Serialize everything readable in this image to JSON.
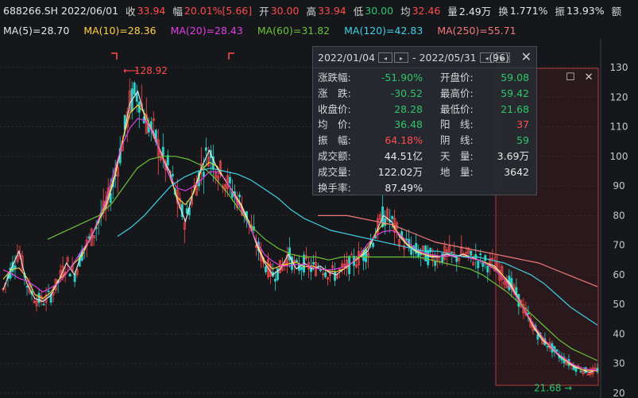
{
  "quote": {
    "code_date": "688266.SH 2022/06/01",
    "close_label": "收",
    "close": "33.94",
    "change_label": "幅",
    "change_pct": "20.01%[5.66]",
    "open_label": "开",
    "open": "30.00",
    "high_label": "高",
    "high": "33.94",
    "low_label": "低",
    "low": "30.00",
    "avg_label": "均",
    "avg": "32.46",
    "volume_label": "量",
    "volume": "2.49万",
    "turnover_label": "换",
    "turnover": "1.771%",
    "amplitude_label": "振",
    "amplitude": "13.93%",
    "amount_label": "额"
  },
  "ma_legend": [
    {
      "label": "MA(5)=28.70",
      "color": "#e8e8e8"
    },
    {
      "label": "MA(10)=28.36",
      "color": "#ffd23f"
    },
    {
      "label": "MA(20)=28.43",
      "color": "#e040e0"
    },
    {
      "label": "MA(60)=31.82",
      "color": "#6ac23a"
    },
    {
      "label": "MA(120)=42.83",
      "color": "#3fd1e6"
    },
    {
      "label": "MA(250)=55.71",
      "color": "#f07a7a"
    }
  ],
  "popup": {
    "range": "2022/01/04 - 2022/05/31",
    "count": "(96)",
    "close_icon": "close-icon",
    "rows_left": [
      {
        "label": "涨跌幅:",
        "value": "-51.90%",
        "color": "#2fc56b"
      },
      {
        "label": "涨　跌:",
        "value": "-30.52",
        "color": "#2fc56b"
      },
      {
        "label": "收盘价:",
        "value": "28.28",
        "color": "#2fc56b"
      },
      {
        "label": "均　价:",
        "value": "36.48",
        "color": "#2fc56b"
      },
      {
        "label": "振　幅:",
        "value": "64.18%",
        "color": "#ff4d4d"
      },
      {
        "label": "成交额:",
        "value": "44.51亿",
        "color": "#e8e8e8"
      },
      {
        "label": "成交量:",
        "value": "122.02万",
        "color": "#e8e8e8"
      },
      {
        "label": "换手率:",
        "value": "87.49%",
        "color": "#e8e8e8"
      }
    ],
    "rows_right": [
      {
        "label": "开盘价:",
        "value": "59.08",
        "color": "#2fc56b"
      },
      {
        "label": "最高价:",
        "value": "59.42",
        "color": "#2fc56b"
      },
      {
        "label": "最低价:",
        "value": "21.68",
        "color": "#2fc56b"
      },
      {
        "label": "阳　线:",
        "value": "37",
        "color": "#ff4d4d"
      },
      {
        "label": "阴　线:",
        "value": "59",
        "color": "#2fc56b"
      },
      {
        "label": "天　量:",
        "value": "3.69万",
        "color": "#e8e8e8"
      },
      {
        "label": "地　量:",
        "value": "3642",
        "color": "#e8e8e8"
      }
    ]
  },
  "chart_data": {
    "type": "candlestick",
    "y_ticks": [
      "130",
      "120",
      "110",
      "100",
      "90",
      "80",
      "70",
      "60",
      "50",
      "40",
      "30",
      "20"
    ],
    "ylim": [
      20,
      130
    ],
    "high_annotation": "128.92",
    "low_annotation": "21.68",
    "close_path": [
      55,
      62,
      68,
      57,
      52,
      51,
      53,
      58,
      64,
      60,
      68,
      72,
      78,
      83,
      92,
      104,
      118,
      122,
      112,
      108,
      100,
      95,
      85,
      78,
      88,
      96,
      102,
      96,
      92,
      88,
      84,
      78,
      70,
      64,
      60,
      62,
      67,
      62,
      64,
      62,
      63,
      61,
      60,
      62,
      64,
      66,
      68,
      74,
      80,
      78,
      73,
      70,
      68,
      67,
      66,
      66,
      67,
      66,
      67,
      66,
      65,
      64,
      63,
      60,
      57,
      52,
      47,
      42,
      38,
      36,
      33,
      31,
      29,
      28,
      27,
      28
    ],
    "ma60_path": [
      72,
      74,
      76,
      78,
      80,
      84,
      90,
      96,
      99,
      100,
      100,
      99,
      97,
      93,
      88,
      82,
      76,
      72,
      69,
      67,
      66,
      66,
      65,
      66,
      66,
      66,
      66,
      66,
      66,
      66,
      65,
      64,
      63,
      62,
      60,
      57,
      54,
      50,
      46,
      42,
      38,
      35,
      33,
      31
    ],
    "ma120_path": [
      73,
      76,
      80,
      85,
      90,
      93,
      95,
      96,
      95,
      94,
      92,
      89,
      86,
      82,
      79,
      77,
      75,
      74,
      73,
      72,
      71,
      70,
      69,
      68,
      68,
      67,
      66,
      66,
      65,
      64,
      62,
      60,
      57,
      53,
      49,
      46,
      43
    ],
    "ma250_path": [
      80,
      80,
      80,
      79,
      78,
      77,
      75,
      73,
      71,
      70,
      69,
      68,
      67,
      66,
      65,
      64,
      62,
      60,
      58,
      56
    ]
  }
}
